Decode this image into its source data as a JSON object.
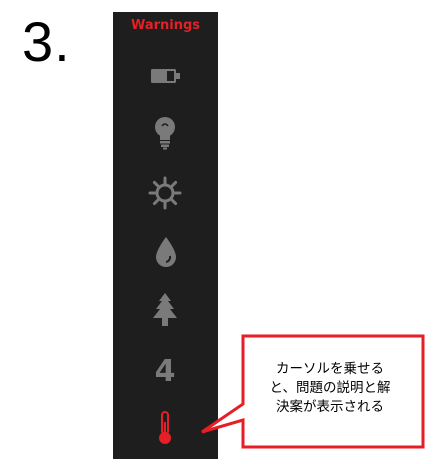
{
  "step": {
    "number_label": "3."
  },
  "warnings_panel": {
    "title": "Warnings",
    "title_color": "#e61e25",
    "background": "#1e1e1e",
    "inactive_icon_color": "#7a7a7a",
    "active_icon_color": "#e61e25",
    "icons": [
      {
        "name": "battery-icon",
        "state": "inactive"
      },
      {
        "name": "lightbulb-icon",
        "state": "inactive"
      },
      {
        "name": "sun-icon",
        "state": "inactive"
      },
      {
        "name": "water-drop-icon",
        "state": "inactive"
      },
      {
        "name": "tree-icon",
        "state": "inactive"
      },
      {
        "name": "number-four-icon",
        "state": "inactive",
        "label": "4"
      },
      {
        "name": "thermometer-icon",
        "state": "active"
      }
    ]
  },
  "callout": {
    "border_color": "#e61e25",
    "lines": [
      "カーソルを乗せる",
      "と、問題の説明と解",
      "決案が表示される"
    ]
  }
}
